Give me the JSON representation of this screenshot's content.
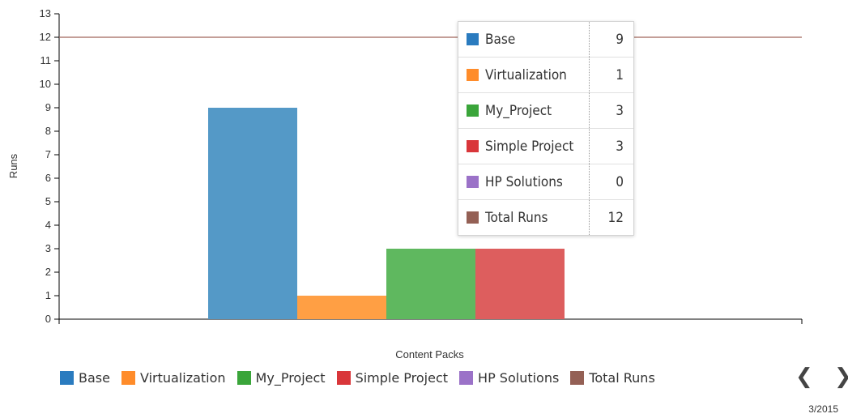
{
  "chart_data": {
    "type": "bar",
    "xlabel": "Content Packs",
    "ylabel": "Runs",
    "ylim": [
      0,
      13
    ],
    "yticks": [
      0,
      1,
      2,
      3,
      4,
      5,
      6,
      7,
      8,
      9,
      10,
      11,
      12,
      13
    ],
    "series": [
      {
        "name": "Base",
        "value": 9,
        "color": "#5499c7"
      },
      {
        "name": "Virtualization",
        "value": 1,
        "color": "#ff9f44"
      },
      {
        "name": "My_Project",
        "value": 3,
        "color": "#5fb85f"
      },
      {
        "name": "Simple Project",
        "value": 3,
        "color": "#dd5e5e"
      },
      {
        "name": "HP Solutions",
        "value": 0,
        "color": "#a57fc9"
      }
    ],
    "reference_line": {
      "name": "Total Runs",
      "value": 12,
      "color": "#a0665a"
    },
    "legend_position": "bottom",
    "grid": false
  },
  "tooltip": {
    "rows": [
      {
        "name": "Base",
        "value": "9",
        "color": "#2a7bbf"
      },
      {
        "name": "Virtualization",
        "value": "1",
        "color": "#ff8c2a"
      },
      {
        "name": "My_Project",
        "value": "3",
        "color": "#3aa53a"
      },
      {
        "name": "Simple Project",
        "value": "3",
        "color": "#d9363a"
      },
      {
        "name": "HP Solutions",
        "value": "0",
        "color": "#9b72c8"
      },
      {
        "name": "Total Runs",
        "value": "12",
        "color": "#946055"
      }
    ]
  },
  "legend": {
    "items": [
      {
        "name": "Base",
        "color": "#2a7bbf"
      },
      {
        "name": "Virtualization",
        "color": "#ff8c2a"
      },
      {
        "name": "My_Project",
        "color": "#3aa53a"
      },
      {
        "name": "Simple Project",
        "color": "#d9363a"
      },
      {
        "name": "HP Solutions",
        "color": "#9b72c8"
      },
      {
        "name": "Total Runs",
        "color": "#946055"
      }
    ]
  },
  "pager": {
    "prev": "❮",
    "next": "❯",
    "page_label": "3/2015"
  },
  "icons": {
    "prev": "chevron-left-icon",
    "next": "chevron-right-icon"
  }
}
